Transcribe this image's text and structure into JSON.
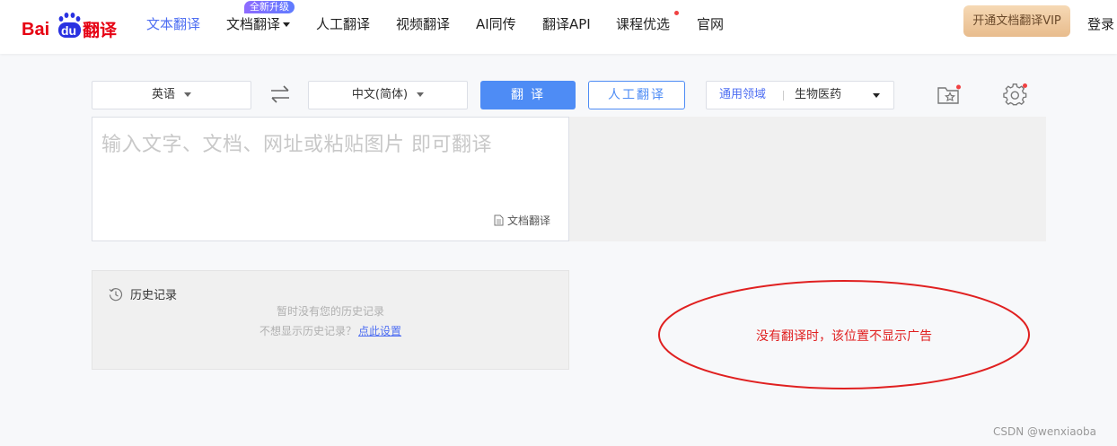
{
  "header": {
    "logo": {
      "brand": "Baidu",
      "text_bai": "Bai",
      "text_du": "du",
      "text_fanyi": "翻译",
      "color_red": "#e60012",
      "color_blue": "#2932e1"
    },
    "nav": [
      {
        "label": "文本翻译",
        "active": true
      },
      {
        "label": "文档翻译",
        "has_dropdown": true,
        "badge": "全新升级"
      },
      {
        "label": "人工翻译"
      },
      {
        "label": "视频翻译"
      },
      {
        "label": "AI同传"
      },
      {
        "label": "翻译API"
      },
      {
        "label": "课程优选",
        "has_dot": true
      },
      {
        "label": "官网"
      }
    ],
    "vip_button": "开通文档翻译VIP",
    "login": "登录"
  },
  "toolbar": {
    "source_lang": "英语",
    "target_lang": "中文(简体)",
    "swap_icon": "swap-arrows-icon",
    "translate_button": "翻译",
    "human_button": "人工翻译",
    "domain_general": "通用领域",
    "domain_value": "生物医药",
    "favorites_icon": "favorites-star-icon",
    "settings_icon": "gear-icon"
  },
  "input": {
    "placeholder": "输入文字、文档、网址或粘贴图片 即可翻译",
    "doc_translate": "文档翻译"
  },
  "history": {
    "title": "历史记录",
    "empty": "暂时没有您的历史记录",
    "prompt": "不想显示历史记录？",
    "link": "点此设置"
  },
  "annotation": {
    "text": "没有翻译时，该位置不显示广告",
    "color": "#e02020"
  },
  "watermark": "CSDN @wenxiaoba",
  "colors": {
    "accent": "#4e6ef2",
    "button_blue": "#4e8cf5",
    "alert_dot": "#f04142"
  }
}
